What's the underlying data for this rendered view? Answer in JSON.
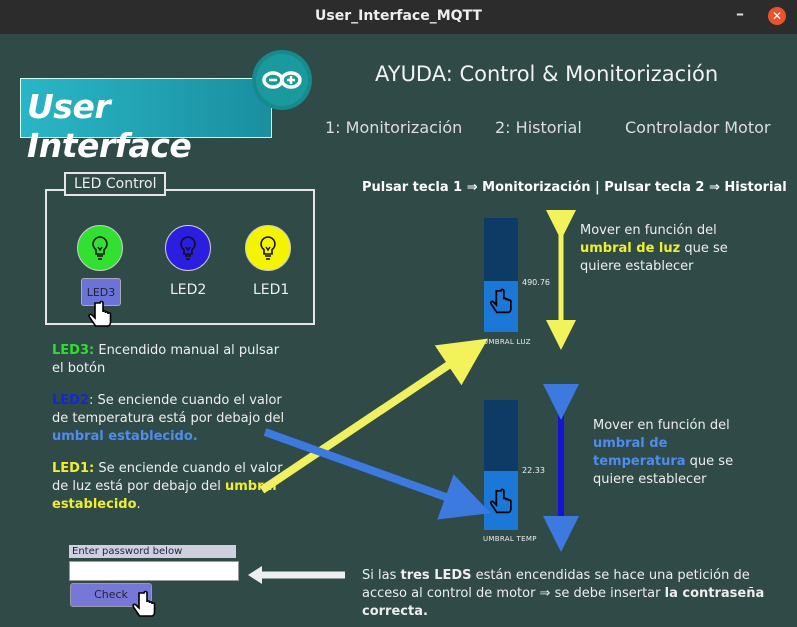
{
  "window": {
    "title": "User_Interface_MQTT",
    "minimize": "–",
    "close": "✕"
  },
  "logo": {
    "text": "User Interface"
  },
  "help_title": "AYUDA: Control & Monitorización",
  "tabs": [
    "1: Monitorización",
    "2: Historial",
    "Controlador Motor"
  ],
  "led_group": {
    "label": "LED Control",
    "led3_button": "LED3",
    "led2_label": "LED2",
    "led1_label": "LED1"
  },
  "led_colors": {
    "led3": "#31e031",
    "led2": "#2b1ee0",
    "led1": "#f4f400"
  },
  "keys_hint": "Pulsar tecla 1 ⇒ Monitorización  |  Pulsar tecla 2 ⇒ Historial",
  "desc": {
    "led3_name": "LED3",
    "led3_text": " Encendido manual al pulsar el botón",
    "led2_name": "LED2",
    "led2_text_a": " Se enciende cuando el valor de temperatura está por debajo del ",
    "led2_text_b": "umbral establecido.",
    "led1_name": "LED1",
    "led1_text_a": " Se enciende cuando el valor de luz está por debajo del ",
    "led1_text_b": "umbral establecido",
    "led1_text_c": "."
  },
  "slider_light": {
    "value": "490.76",
    "caption": "UMBRAL LUZ",
    "level": 0.45
  },
  "slider_temp": {
    "value": "22.33",
    "caption": "UMBRAL TEMP",
    "level": 0.45
  },
  "light_note": {
    "a": "Mover en función del ",
    "b": "umbral de luz",
    "c": " que se quiere establecer"
  },
  "temp_note": {
    "a": "Mover en función del ",
    "b": "umbral de temperatura",
    "c": " que se quiere establecer"
  },
  "password": {
    "label": "Enter password below",
    "value": "",
    "check": "Check"
  },
  "access_note": {
    "a": "Si las ",
    "b": "tres LEDS",
    "c": " están encendidas se hace una petición de acceso al control de motor ⇒ se debe insertar ",
    "d": "la contraseña correcta."
  }
}
